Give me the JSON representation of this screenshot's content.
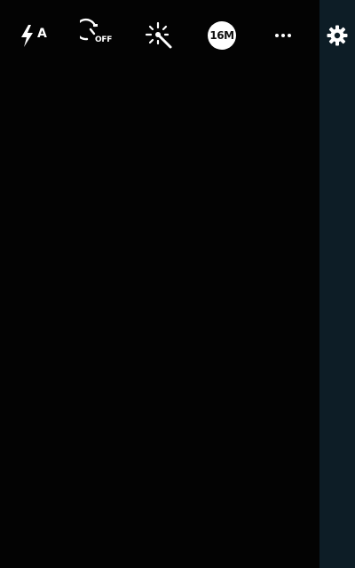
{
  "colors": {
    "background": "#000000",
    "side_panel": "#0d1d26",
    "icon": "#ffffff"
  },
  "toolbar": {
    "flash": {
      "icon": "flash-auto-icon",
      "label": "A"
    },
    "timer": {
      "icon": "timer-off-icon",
      "label": "OFF"
    },
    "effects": {
      "icon": "magic-wand-icon"
    },
    "resolution": {
      "icon": "resolution-badge",
      "label": "16M"
    },
    "more": {
      "icon": "more-dots-icon"
    },
    "settings": {
      "icon": "gear-icon"
    }
  }
}
